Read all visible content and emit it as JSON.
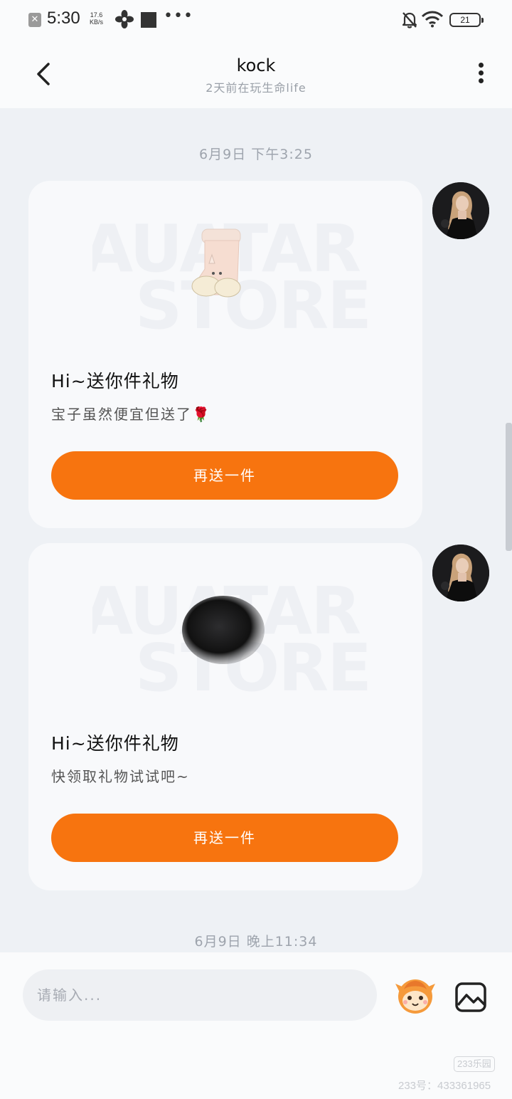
{
  "status_bar": {
    "time": "5:30",
    "speed_value": "17.6",
    "speed_unit": "KB/s",
    "more": "•••",
    "battery": "21"
  },
  "header": {
    "title": "kock",
    "subtitle": "2天前在玩生命life"
  },
  "messages": [
    {
      "timestamp": "6月9日 下午3:25",
      "card_title": "Hi~送你件礼物",
      "card_desc": "宝子虽然便宜但送了🌹",
      "button": "再送一件",
      "watermark_top": "AUATAR",
      "watermark_bottom": "STORE"
    },
    {
      "card_title": "Hi~送你件礼物",
      "card_desc": "快领取礼物试试吧~",
      "button": "再送一件",
      "watermark_top": "AUATAR",
      "watermark_bottom": "STORE"
    }
  ],
  "last_timestamp": "6月9日 晚上11:34",
  "input": {
    "placeholder": "请输入..."
  },
  "watermark": {
    "logo": "233乐园",
    "id": "233号：433361965"
  },
  "colors": {
    "accent": "#f7740f",
    "background": "#eef1f5",
    "card": "#f8f9fb"
  },
  "icons": {
    "back": "chevron-left-icon",
    "more": "more-vertical-icon",
    "emoji": "mascot-emoji-icon",
    "image": "image-icon"
  }
}
